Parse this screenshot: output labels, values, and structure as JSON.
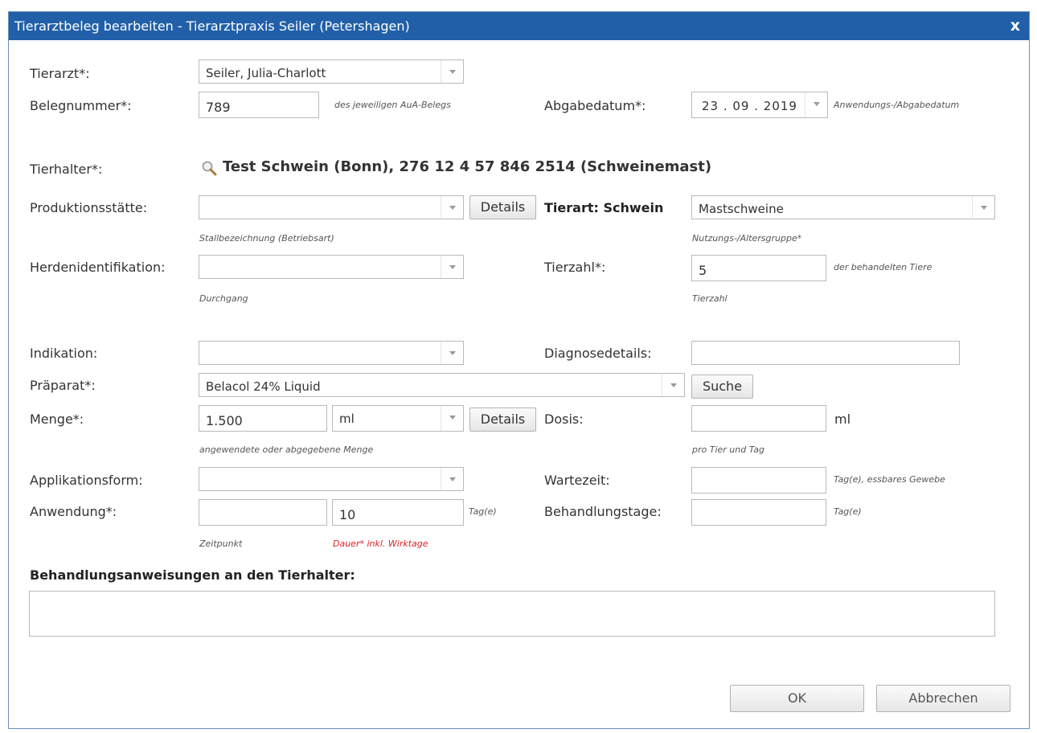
{
  "dialog": {
    "title": "Tierarztbeleg bearbeiten - Tierarztpraxis Seiler (Petershagen)",
    "close": "x"
  },
  "tierarzt": {
    "label": "Tierarzt*:",
    "value": "Seiler, Julia-Charlott"
  },
  "belegnummer": {
    "label": "Belegnummer*:",
    "value": "789",
    "hint": "des jeweiligen AuA-Belegs"
  },
  "abgabedatum": {
    "label": "Abgabedatum*:",
    "value": "23 . 09 . 2019",
    "hint": "Anwendungs-/Abgabedatum"
  },
  "tierhalter": {
    "label": "Tierhalter*:",
    "value": "Test Schwein (Bonn), 276 12 4 57 846 2514 (Schweinemast)"
  },
  "produktionsstaette": {
    "label": "Produktionsstätte:",
    "value": "",
    "hint": "Stallbezeichnung (Betriebsart)",
    "details_button": "Details"
  },
  "tierart": {
    "label": "Tierart: Schwein",
    "value": "Mastschweine",
    "hint": "Nutzungs-/Altersgruppe*"
  },
  "herden": {
    "label": "Herdenidentifikation:",
    "value": "",
    "hint": "Durchgang"
  },
  "tierzahl": {
    "label": "Tierzahl*:",
    "value": "5",
    "hint_right": "der behandelten Tiere",
    "hint_below": "Tierzahl"
  },
  "indikation": {
    "label": "Indikation:",
    "value": ""
  },
  "diagnose": {
    "label": "Diagnosedetails:",
    "value": ""
  },
  "praeparat": {
    "label": "Präparat*:",
    "value": "Belacol 24% Liquid",
    "search_button": "Suche"
  },
  "menge": {
    "label": "Menge*:",
    "value": "1.500",
    "unit": "ml",
    "details_button": "Details",
    "hint": "angewendete oder abgegebene Menge"
  },
  "dosis": {
    "label": "Dosis:",
    "value": "",
    "unit": "ml",
    "hint": "pro Tier und Tag"
  },
  "applikation": {
    "label": "Applikationsform:",
    "value": ""
  },
  "wartezeit": {
    "label": "Wartezeit:",
    "value": "",
    "hint": "Tag(e), essbares Gewebe"
  },
  "anwendung": {
    "label": "Anwendung*:",
    "zeitpunkt": "",
    "dauer": "10",
    "unit": "Tag(e)",
    "hint_zeitpunkt": "Zeitpunkt",
    "hint_dauer": "Dauer* inkl. Wirktage"
  },
  "behandlungstage": {
    "label": "Behandlungstage:",
    "value": "",
    "unit": "Tag(e)"
  },
  "anweisungen": {
    "label": "Behandlungsanweisungen an den Tierhalter:",
    "value": ""
  },
  "footer": {
    "ok": "OK",
    "cancel": "Abbrechen"
  }
}
